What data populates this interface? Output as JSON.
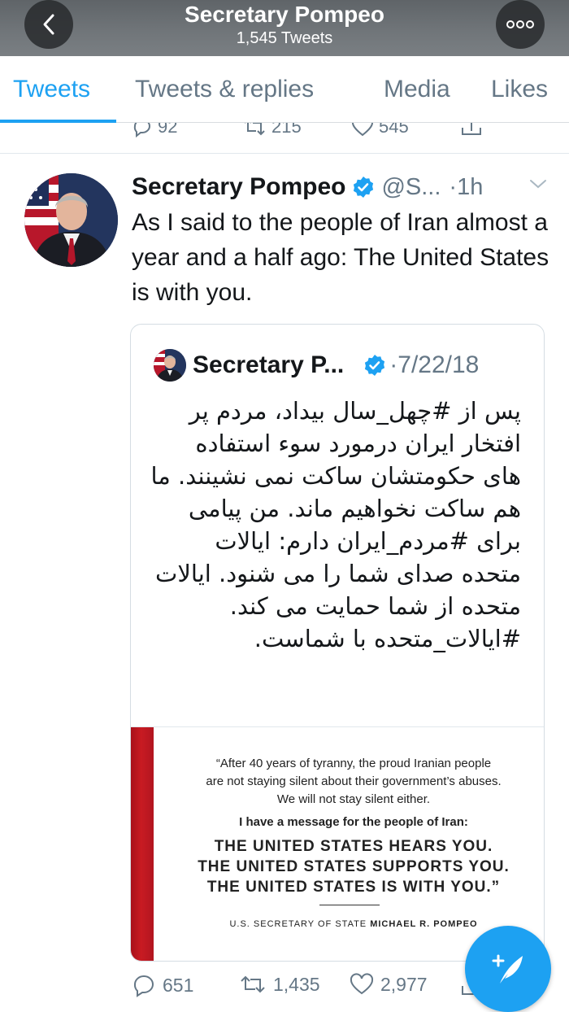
{
  "header": {
    "title": "Secretary Pompeo",
    "subtitle": "1,545 Tweets",
    "back_icon": "chevron-left-icon",
    "more_icon": "more-dots-icon"
  },
  "tabs": [
    {
      "label": "Tweets",
      "active": true
    },
    {
      "label": "Tweets & replies",
      "active": false
    },
    {
      "label": "Media",
      "active": false
    },
    {
      "label": "Likes",
      "active": false
    }
  ],
  "previous_tweet": {
    "replies": "92",
    "retweets": "215",
    "likes": "545"
  },
  "tweet": {
    "display_name": "Secretary Pompeo",
    "handle": "@S...",
    "time": "·1h",
    "text": "As I said to the people of Iran almost a year and a half ago: The United States is with you.",
    "quoted": {
      "display_name": "Secretary P...",
      "time": "·7/22/18",
      "text": "پس از #چهل_سال بیداد، مردم پر افتخار ایران درمورد سوء استفاده های حکومتشان ساکت نمی نشینند. ما هم ساکت نخواهیم ماند. من پیامی برای #مردم_ایران دارم: ایالات متحده صدای شما را می شنود. ایالات متحده از شما حمایت می کند. #ایالات_متحده با شماست.",
      "image": {
        "line1": "“After 40 years of tyranny, the proud Iranian people",
        "line2": "are not staying silent about their government’s abuses.",
        "line3": "We will not stay silent either.",
        "line4": "I have a message for the people of Iran:",
        "line5": "THE UNITED STATES HEARS YOU.",
        "line6": "THE UNITED STATES SUPPORTS YOU.",
        "line7": "THE UNITED STATES IS WITH YOU.”",
        "sig_prefix": "U.S. SECRETARY OF STATE ",
        "sig_name": "MICHAEL R. POMPEO"
      }
    },
    "replies": "651",
    "retweets": "1,435",
    "likes": "2,977"
  },
  "colors": {
    "accent": "#1da1f2",
    "secondary_text": "#657786",
    "header_bg": "#6b7074"
  },
  "fab": {
    "icon": "compose-tweet-icon"
  }
}
